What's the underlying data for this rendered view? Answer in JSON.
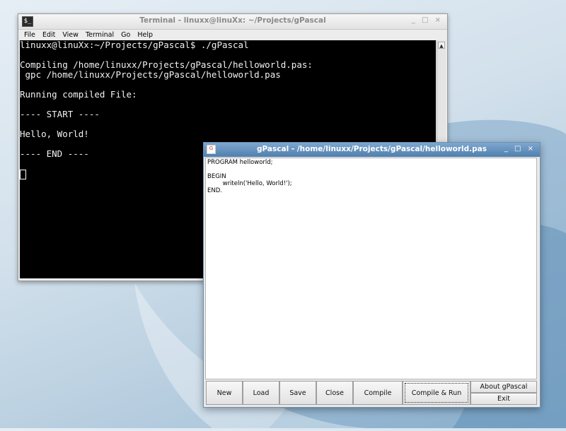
{
  "terminal": {
    "title": "Terminal - linuxx@linuXx: ~/Projects/gPascal",
    "app_icon": "$_",
    "menu": [
      "File",
      "Edit",
      "View",
      "Terminal",
      "Go",
      "Help"
    ],
    "lines": [
      "linuxx@linuXx:~/Projects/gPascal$ ./gPascal",
      "",
      "Compiling /home/linuxx/Projects/gPascal/helloworld.pas:",
      " gpc /home/linuxx/Projects/gPascal/helloworld.pas",
      "",
      "Running compiled File:",
      "",
      "---- START ----",
      "",
      "Hello, World!",
      "",
      "---- END ----",
      ""
    ],
    "controls": "_ □ ×"
  },
  "gpascal": {
    "title": "gPascal - /home/linuxx/Projects/gPascal/helloworld.pas",
    "controls": "_ □ ×",
    "code": [
      "PROGRAM helloworld;",
      "",
      "BEGIN",
      "        writeln('Hello, World!');",
      "END."
    ],
    "buttons": {
      "new": "New",
      "load": "Load",
      "save": "Save",
      "close": "Close",
      "compile": "Compile",
      "compile_run": "Compile & Run",
      "about": "About gPascal",
      "exit": "Exit"
    }
  },
  "colors": {
    "terminal_bg": "#000000",
    "titlebar_active": "#5e8cb9",
    "desktop": "#c9dae8"
  }
}
